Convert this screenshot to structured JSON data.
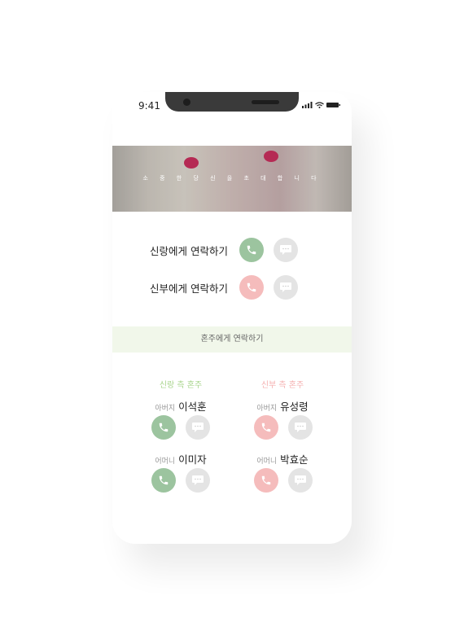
{
  "status_bar": {
    "time": "9:41"
  },
  "banner": {
    "text": "소 중 한   당 신 을   초 대 합 니 다"
  },
  "contacts": [
    {
      "label": "신랑에게 연락하기",
      "color": "#9cc49f"
    },
    {
      "label": "신부에게 연락하기",
      "color": "#f5bcbc"
    }
  ],
  "parents_section": {
    "title": "혼주에게 연락하기",
    "groom_side": {
      "heading": "신랑 측 혼주",
      "color": "#a8d48c",
      "people": [
        {
          "role": "아버지",
          "name": "이석훈"
        },
        {
          "role": "어머니",
          "name": "이미자"
        }
      ]
    },
    "bride_side": {
      "heading": "신부 측 혼주",
      "color": "#f5b0b0",
      "people": [
        {
          "role": "아버지",
          "name": "유성령"
        },
        {
          "role": "어머니",
          "name": "박효순"
        }
      ]
    }
  }
}
